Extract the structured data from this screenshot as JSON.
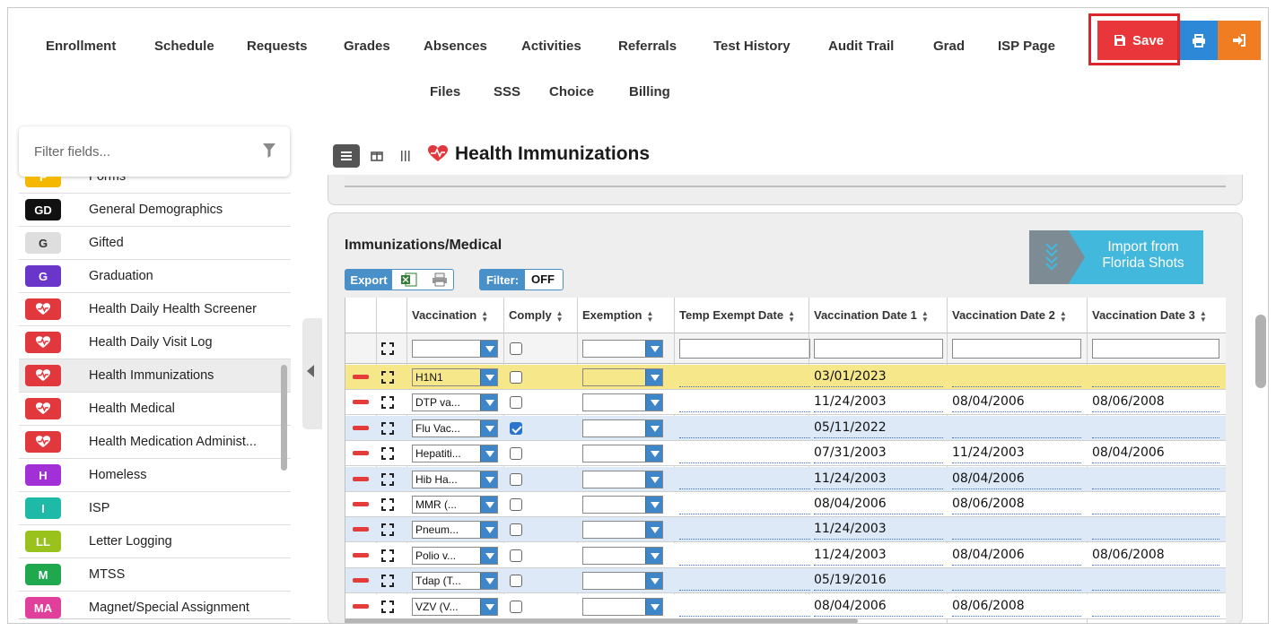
{
  "nav": {
    "row1": [
      "Enrollment",
      "Schedule",
      "Requests",
      "Grades",
      "Absences",
      "Activities",
      "Referrals",
      "Test History",
      "Audit Trail",
      "Grad",
      "ISP Page"
    ],
    "row2": [
      "Files",
      "SSS",
      "Choice",
      "Billing"
    ],
    "save_label": "Save"
  },
  "colors": {
    "save": "#e8363a",
    "print": "#2d88d8",
    "exit": "#f07d22",
    "import": "#42b8dd",
    "heart": "#e0383c"
  },
  "sidebar": {
    "filter_placeholder": "Filter fields...",
    "items": [
      {
        "badge": "F",
        "label": "Forms",
        "color": "#f5b800"
      },
      {
        "badge": "GD",
        "label": "General Demographics",
        "color": "#111111"
      },
      {
        "badge": "G",
        "label": "Gifted",
        "color": "#dedede"
      },
      {
        "badge": "G",
        "label": "Graduation",
        "color": "#6a35c9"
      },
      {
        "badge": "heart-icon",
        "label": "Health Daily Health Screener",
        "color": "#e0383c"
      },
      {
        "badge": "heart-icon",
        "label": "Health Daily Visit Log",
        "color": "#e0383c"
      },
      {
        "badge": "heart-icon",
        "label": "Health Immunizations",
        "color": "#e0383c",
        "active": true
      },
      {
        "badge": "heart-icon",
        "label": "Health Medical",
        "color": "#e0383c"
      },
      {
        "badge": "heart-icon",
        "label": "Health Medication Administ...",
        "color": "#e0383c"
      },
      {
        "badge": "H",
        "label": "Homeless",
        "color": "#a131d6"
      },
      {
        "badge": "I",
        "label": "ISP",
        "color": "#1fb9a8"
      },
      {
        "badge": "LL",
        "label": "Letter Logging",
        "color": "#9ac21c"
      },
      {
        "badge": "M",
        "label": "MTSS",
        "color": "#1fa84e"
      },
      {
        "badge": "MA",
        "label": "Magnet/Special Assignment",
        "color": "#e0409a"
      }
    ]
  },
  "page": {
    "title": "Health Immunizations"
  },
  "panel": {
    "title": "Immunizations/Medical",
    "import_label_1": "Import from",
    "import_label_2": "Florida Shots",
    "export_label": "Export",
    "filter_label": "Filter:",
    "filter_value": "OFF"
  },
  "grid": {
    "headers": [
      "Vaccination",
      "Comply",
      "Exemption",
      "Temp Exempt Date",
      "Vaccination Date 1",
      "Vaccination Date 2",
      "Vaccination Date 3"
    ],
    "rows": [
      {
        "vaccination": "H1N1",
        "comply": false,
        "d1": "03/01/2023",
        "d2": "",
        "d3": "",
        "style": "yellow"
      },
      {
        "vaccination": "DTP va...",
        "comply": false,
        "d1": "11/24/2003",
        "d2": "08/04/2006",
        "d3": "08/06/2008",
        "style": "white"
      },
      {
        "vaccination": "Flu Vac...",
        "comply": true,
        "d1": "05/11/2022",
        "d2": "",
        "d3": "",
        "style": "blue"
      },
      {
        "vaccination": "Hepatiti...",
        "comply": false,
        "d1": "07/31/2003",
        "d2": "11/24/2003",
        "d3": "08/04/2006",
        "style": "white"
      },
      {
        "vaccination": "Hib Ha...",
        "comply": false,
        "d1": "11/24/2003",
        "d2": "08/04/2006",
        "d3": "",
        "style": "blue"
      },
      {
        "vaccination": "MMR (...",
        "comply": false,
        "d1": "08/04/2006",
        "d2": "08/06/2008",
        "d3": "",
        "style": "white"
      },
      {
        "vaccination": "Pneum...",
        "comply": false,
        "d1": "11/24/2003",
        "d2": "",
        "d3": "",
        "style": "blue"
      },
      {
        "vaccination": "Polio v...",
        "comply": false,
        "d1": "11/24/2003",
        "d2": "08/04/2006",
        "d3": "08/06/2008",
        "style": "white"
      },
      {
        "vaccination": "Tdap (T...",
        "comply": false,
        "d1": "05/19/2016",
        "d2": "",
        "d3": "",
        "style": "blue"
      },
      {
        "vaccination": "VZV (V...",
        "comply": false,
        "d1": "08/04/2006",
        "d2": "08/06/2008",
        "d3": "",
        "style": "white"
      }
    ]
  }
}
